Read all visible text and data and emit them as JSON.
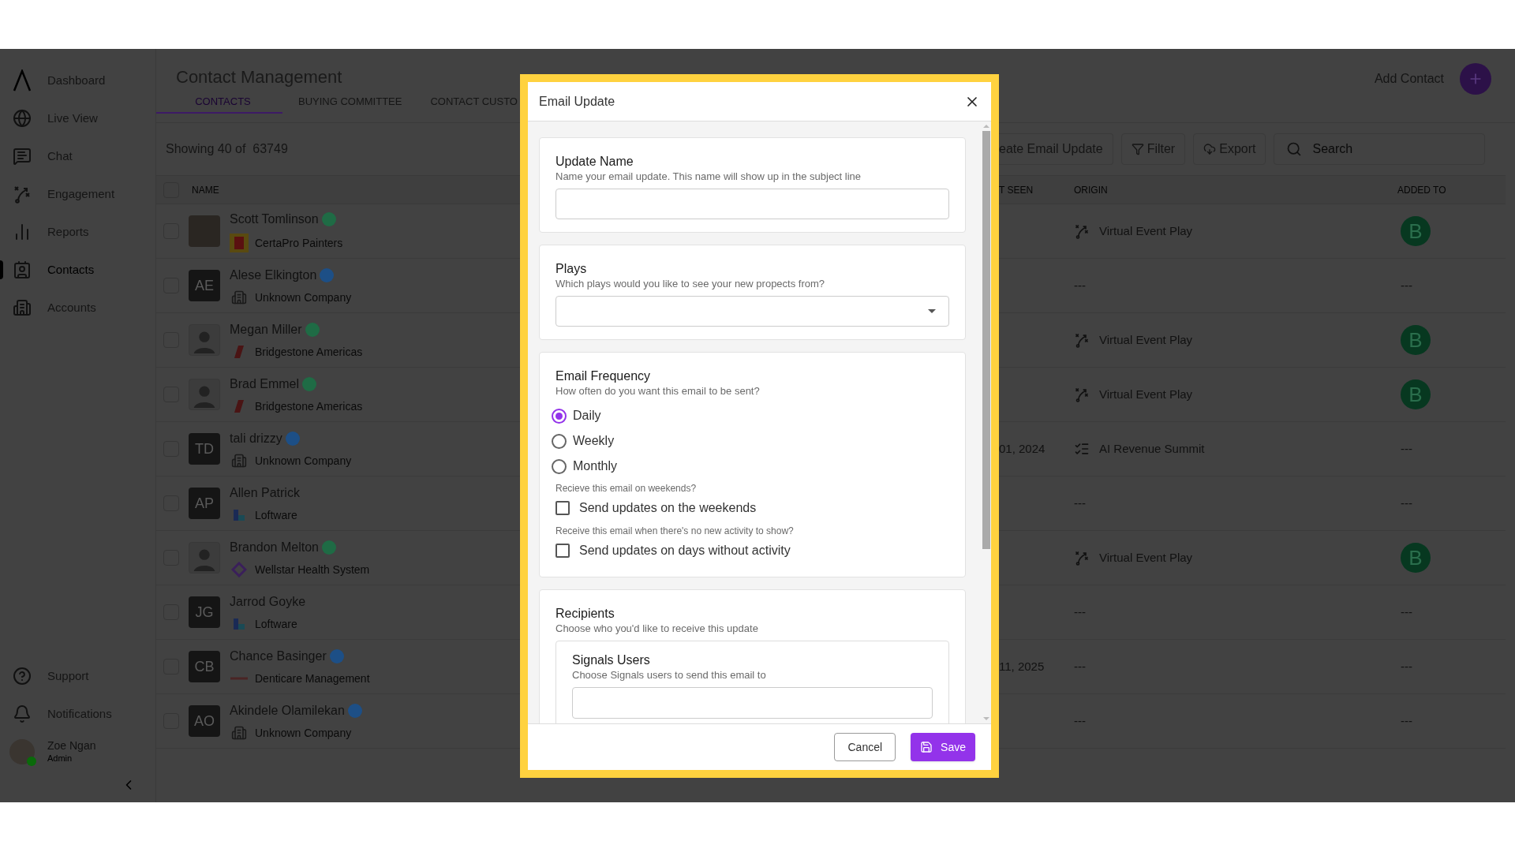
{
  "sidebar": {
    "items": [
      {
        "label": "Dashboard",
        "selected": false
      },
      {
        "label": "Live View",
        "selected": false
      },
      {
        "label": "Chat",
        "selected": false
      },
      {
        "label": "Engagement",
        "selected": false
      },
      {
        "label": "Reports",
        "selected": false
      },
      {
        "label": "Contacts",
        "selected": true
      },
      {
        "label": "Accounts",
        "selected": false
      }
    ],
    "bottom_items": [
      {
        "label": "Support"
      },
      {
        "label": "Notifications"
      }
    ],
    "user": {
      "name": "Zoe Ngan",
      "role": "Admin",
      "online": true
    }
  },
  "header": {
    "title": "Contact Management",
    "tabs": [
      {
        "label": "CONTACTS",
        "selected": true
      },
      {
        "label": "BUYING COMMITTEE",
        "selected": false
      },
      {
        "label": "CONTACT CUSTO",
        "selected": false
      }
    ],
    "add_contact": "Add Contact"
  },
  "toolbar": {
    "count": "Showing 40 of  63749",
    "buttons": [
      "eate Email Update",
      "Filter",
      "Export"
    ],
    "search_placeholder": "Search"
  },
  "table": {
    "columns": [
      "NAME",
      "T SEEN",
      "ORIGIN",
      "ADDED TO"
    ],
    "header_checkbox": {
      "checked": false
    },
    "rows": [
      {
        "name": "Scott Tomlinson",
        "color": "#1f6b45",
        "avatar": {
          "kind": "photo"
        },
        "company": {
          "kind": "square",
          "name": "CertaPro Painters"
        },
        "checked": false,
        "origin": {
          "kind": "play",
          "text": "Virtual Event Play"
        },
        "added_to": "B"
      },
      {
        "name": "Alese Elkington",
        "color": "#1d4f86",
        "avatar": {
          "kind": "initials",
          "initials": "AE"
        },
        "company": {
          "kind": "building",
          "name": "Unknown Company"
        },
        "checked": false,
        "origin": {
          "kind": "plain",
          "text": "---"
        },
        "added_to": "---"
      },
      {
        "name": "Megan Miller",
        "color": "#1f6b45",
        "avatar": {
          "kind": "silhouette"
        },
        "company": {
          "kind": "stripe",
          "name": "Bridgestone Americas"
        },
        "checked": false,
        "origin": {
          "kind": "play",
          "text": "Virtual Event Play"
        },
        "added_to": "B"
      },
      {
        "name": "Brad Emmel",
        "color": "#1f6b45",
        "avatar": {
          "kind": "silhouette"
        },
        "company": {
          "kind": "stripe",
          "name": "Bridgestone Americas"
        },
        "checked": false,
        "origin": {
          "kind": "play",
          "text": "Virtual Event Play"
        },
        "added_to": "B"
      },
      {
        "name": "tali drizzy",
        "color": "#1d4f86",
        "avatar": {
          "kind": "initials",
          "initials": "TD"
        },
        "company": {
          "kind": "building",
          "name": "Unknown Company"
        },
        "checked": false,
        "last_seen": "01, 2024",
        "origin": {
          "kind": "event",
          "text": "AI Revenue Summit"
        },
        "added_to": "---"
      },
      {
        "name": "Allen Patrick",
        "avatar": {
          "kind": "initials",
          "initials": "AP"
        },
        "company": {
          "kind": "blocks",
          "name": "Loftware"
        },
        "checked": false,
        "origin": {
          "kind": "plain",
          "text": "---"
        },
        "added_to": "---"
      },
      {
        "name": "Brandon Melton",
        "color": "#1f6b45",
        "avatar": {
          "kind": "silhouette"
        },
        "company": {
          "kind": "diamond",
          "name": "Wellstar Health System"
        },
        "checked": false,
        "origin": {
          "kind": "play",
          "text": "Virtual Event Play"
        },
        "added_to": "B"
      },
      {
        "name": "Jarrod Goyke",
        "avatar": {
          "kind": "initials",
          "initials": "JG"
        },
        "company": {
          "kind": "blocks",
          "name": "Loftware"
        },
        "checked": false,
        "origin": {
          "kind": "plain",
          "text": "---"
        },
        "added_to": "---"
      },
      {
        "name": "Chance Basinger",
        "color": "#1d4f86",
        "avatar": {
          "kind": "initials",
          "initials": "CB"
        },
        "company": {
          "kind": "wordmark",
          "name": "Denticare Management"
        },
        "checked": false,
        "last_seen": "11, 2025",
        "origin": {
          "kind": "plain",
          "text": "---"
        },
        "added_to": "---"
      },
      {
        "name": "Akindele Olamilekan",
        "color": "#1d4f86",
        "avatar": {
          "kind": "initials",
          "initials": "AO"
        },
        "company": {
          "kind": "building",
          "name": "Unknown Company"
        },
        "checked": false,
        "origin": {
          "kind": "plain",
          "text": "---"
        },
        "added_to": "---"
      }
    ]
  },
  "modal": {
    "title": "Email Update",
    "sections": [
      {
        "kind": "text",
        "title": "Update Name",
        "description": "Name your email update. This name will show up in the subject line"
      },
      {
        "kind": "select",
        "title": "Plays",
        "description": "Which plays would you like to see your new propects from?"
      },
      {
        "kind": "frequency",
        "title": "Email Frequency",
        "description": "How often do you want this email to be sent?",
        "options": [
          {
            "label": "Daily",
            "selected": true
          },
          {
            "label": "Weekly",
            "selected": false
          },
          {
            "label": "Monthly",
            "selected": false
          }
        ],
        "checks": [
          {
            "question": "Recieve this email on weekends?",
            "label": "Send updates on the weekends",
            "checked": false
          },
          {
            "question": "Receive this email when there's no new activity to show?",
            "label": "Send updates on days without activity",
            "checked": false
          }
        ]
      },
      {
        "kind": "recipients",
        "title": "Recipients",
        "description": "Choose who you'd like to receive this update",
        "sub_title": "Signals Users",
        "sub_description": "Choose Signals users to send this email to"
      }
    ],
    "cancel": "Cancel",
    "save": "Save"
  }
}
